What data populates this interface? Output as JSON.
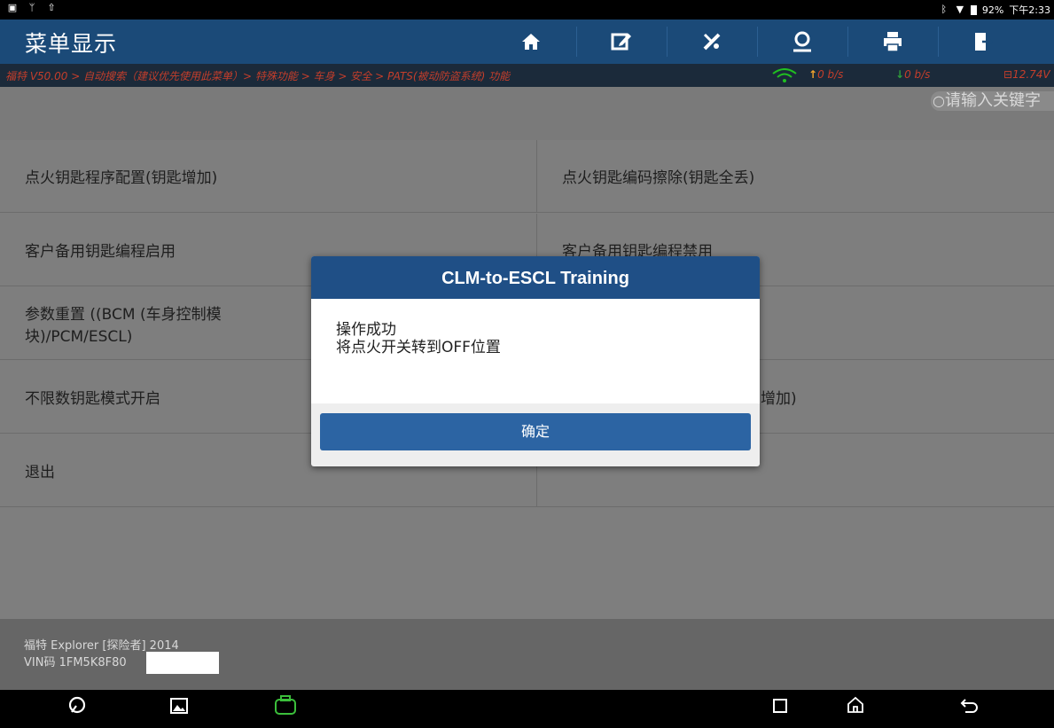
{
  "status_bar": {
    "battery": "92%",
    "time": "下午2:33"
  },
  "header": {
    "title": "菜单显示",
    "tools": [
      {
        "icon": "home-icon",
        "glyph": "⌂"
      },
      {
        "icon": "edit-report-icon",
        "glyph": "✎"
      },
      {
        "icon": "tools-icon",
        "glyph": "⚒"
      },
      {
        "icon": "user-icon",
        "glyph": "☺"
      },
      {
        "icon": "print-icon",
        "glyph": "⎙"
      },
      {
        "icon": "exit-icon",
        "glyph": "⇥"
      }
    ]
  },
  "breadcrumb": "福特 V50.00 > 自动搜索（建议优先使用此菜单）> 特殊功能 > 车身 > 安全 > PATS(被动防盗系统) 功能",
  "network": {
    "up": "0 b/s",
    "down": "0 b/s",
    "voltage": "12.74V"
  },
  "search": {
    "placeholder": "请输入关键字"
  },
  "menu": {
    "left": [
      "点火钥匙程序配置(钥匙增加)",
      "客户备用钥匙编程启用",
      "参数重置 ((BCM (车身控制模块)/PCM/ESCL)",
      "不限数钥匙模式开启",
      "退出"
    ],
    "right": [
      "点火钥匙编码擦除(钥匙全丢)",
      "客户备用钥匙编程禁用",
      "",
      "增加)",
      ""
    ]
  },
  "dialog": {
    "title": "CLM-to-ESCL Training",
    "line1": "操作成功",
    "line2": "将点火开关转到OFF位置",
    "ok": "确定"
  },
  "footer": {
    "car": "福特 Explorer [探险者] 2014",
    "vin": "VIN码 1FM5K8F80"
  },
  "colors": {
    "header": "#1b4a78",
    "dialog_header": "#1f4f86",
    "button": "#2c64a3",
    "breadcrumb": "#c43e2b"
  }
}
